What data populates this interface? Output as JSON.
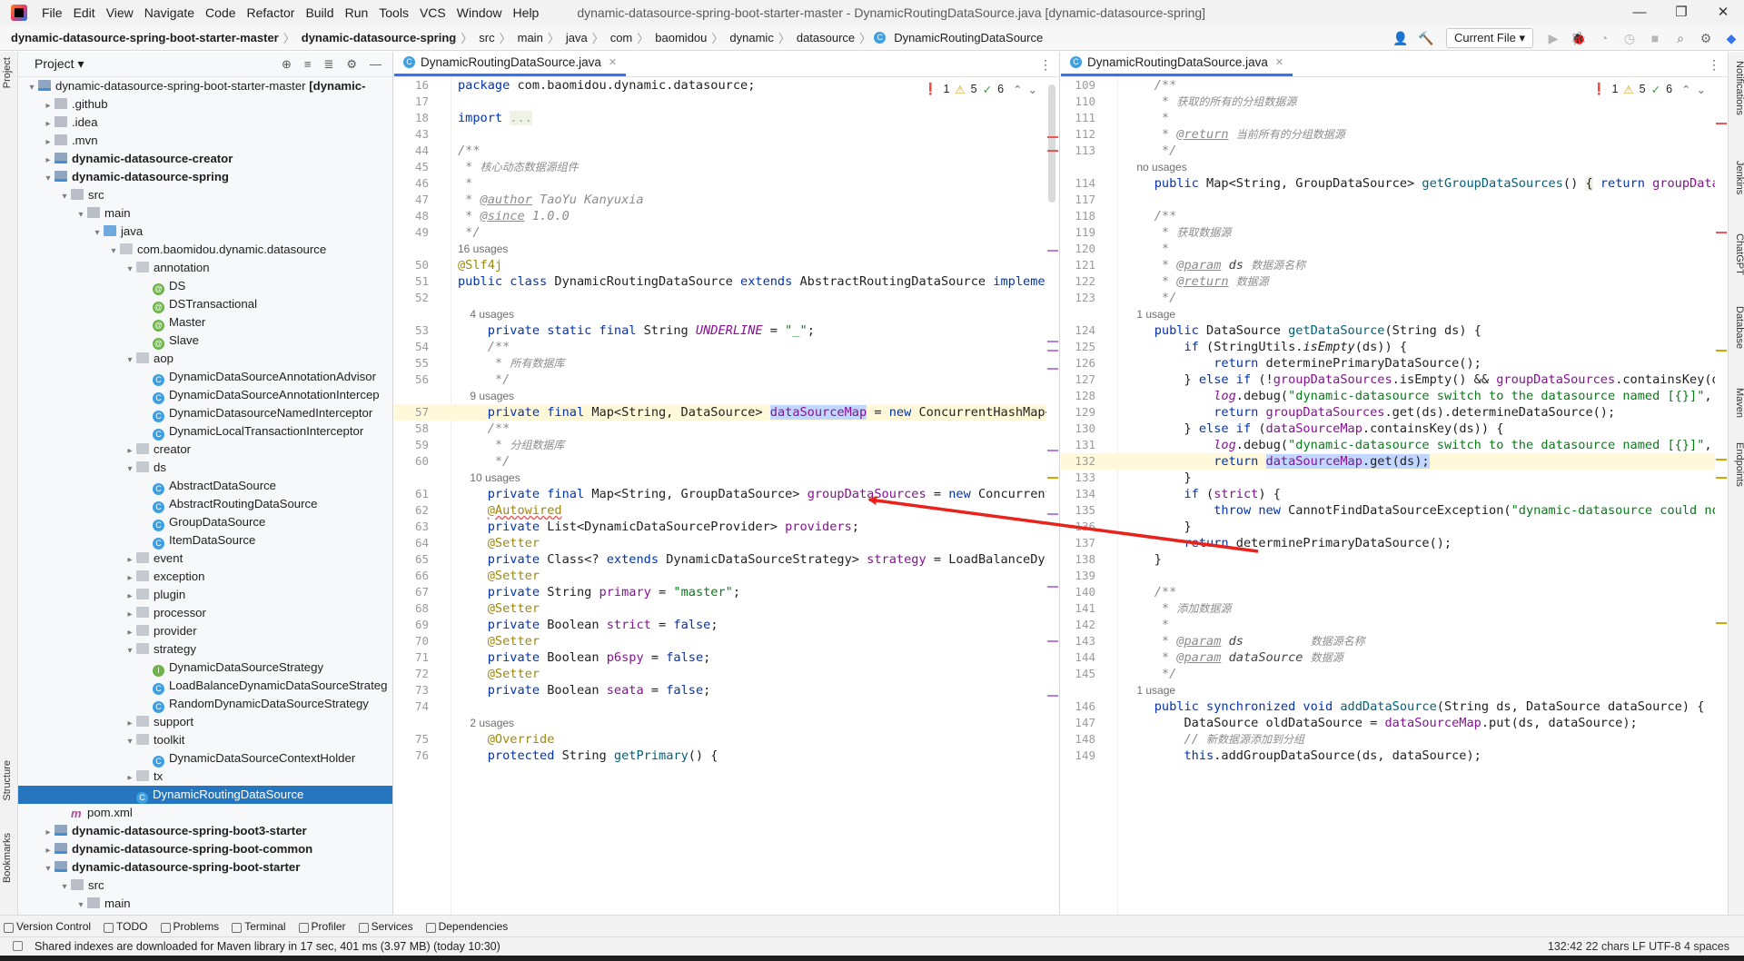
{
  "menu": [
    "File",
    "Edit",
    "View",
    "Navigate",
    "Code",
    "Refactor",
    "Build",
    "Run",
    "Tools",
    "VCS",
    "Window",
    "Help"
  ],
  "window_title": "dynamic-datasource-spring-boot-starter-master - DynamicRoutingDataSource.java [dynamic-datasource-spring]",
  "window_controls": {
    "minimize": "—",
    "restore": "❐",
    "close": "✕"
  },
  "breadcrumbs": [
    {
      "label": "dynamic-datasource-spring-boot-starter-master",
      "bold": true
    },
    {
      "label": "dynamic-datasource-spring",
      "bold": true
    },
    {
      "label": "src"
    },
    {
      "label": "main"
    },
    {
      "label": "java"
    },
    {
      "label": "com"
    },
    {
      "label": "baomidou"
    },
    {
      "label": "dynamic"
    },
    {
      "label": "datasource"
    },
    {
      "label": "DynamicRoutingDataSource",
      "icon": "C"
    }
  ],
  "run_config": "Current File ▾",
  "left_strip": [
    "Project",
    "Structure",
    "Bookmarks"
  ],
  "right_strip": [
    "Notifications",
    "Jenkins",
    "ChatGPT",
    "Database",
    "Maven",
    "Endpoints"
  ],
  "project_panel": {
    "title": "Project ▾"
  },
  "tree": [
    {
      "d": 0,
      "a": "▾",
      "i": "module",
      "t": "dynamic-datasource-spring-boot-starter-master",
      "extra": " [dynamic-",
      "bold": false
    },
    {
      "d": 1,
      "a": "▸",
      "i": "folder",
      "t": ".github"
    },
    {
      "d": 1,
      "a": "▸",
      "i": "folder",
      "t": ".idea"
    },
    {
      "d": 1,
      "a": "▸",
      "i": "folder",
      "t": ".mvn"
    },
    {
      "d": 1,
      "a": "▸",
      "i": "module",
      "t": "dynamic-datasource-creator",
      "bold": true
    },
    {
      "d": 1,
      "a": "▾",
      "i": "module",
      "t": "dynamic-datasource-spring",
      "bold": true
    },
    {
      "d": 2,
      "a": "▾",
      "i": "folder",
      "t": "src"
    },
    {
      "d": 3,
      "a": "▾",
      "i": "folder",
      "t": "main"
    },
    {
      "d": 4,
      "a": "▾",
      "i": "folder-blue",
      "t": "java"
    },
    {
      "d": 5,
      "a": "▾",
      "i": "package",
      "t": "com.baomidou.dynamic.datasource"
    },
    {
      "d": 6,
      "a": "▾",
      "i": "package",
      "t": "annotation"
    },
    {
      "d": 7,
      "a": "",
      "i": "ann",
      "t": "DS"
    },
    {
      "d": 7,
      "a": "",
      "i": "ann",
      "t": "DSTransactional"
    },
    {
      "d": 7,
      "a": "",
      "i": "ann",
      "t": "Master"
    },
    {
      "d": 7,
      "a": "",
      "i": "ann",
      "t": "Slave"
    },
    {
      "d": 6,
      "a": "▾",
      "i": "package",
      "t": "aop"
    },
    {
      "d": 7,
      "a": "",
      "i": "cls",
      "t": "DynamicDataSourceAnnotationAdvisor"
    },
    {
      "d": 7,
      "a": "",
      "i": "cls",
      "t": "DynamicDataSourceAnnotationIntercep"
    },
    {
      "d": 7,
      "a": "",
      "i": "cls",
      "t": "DynamicDatasourceNamedInterceptor"
    },
    {
      "d": 7,
      "a": "",
      "i": "cls",
      "t": "DynamicLocalTransactionInterceptor"
    },
    {
      "d": 6,
      "a": "▸",
      "i": "package",
      "t": "creator"
    },
    {
      "d": 6,
      "a": "▾",
      "i": "package",
      "t": "ds"
    },
    {
      "d": 7,
      "a": "",
      "i": "cls",
      "t": "AbstractDataSource"
    },
    {
      "d": 7,
      "a": "",
      "i": "cls",
      "t": "AbstractRoutingDataSource"
    },
    {
      "d": 7,
      "a": "",
      "i": "cls",
      "t": "GroupDataSource"
    },
    {
      "d": 7,
      "a": "",
      "i": "cls",
      "t": "ItemDataSource"
    },
    {
      "d": 6,
      "a": "▸",
      "i": "package",
      "t": "event"
    },
    {
      "d": 6,
      "a": "▸",
      "i": "package",
      "t": "exception"
    },
    {
      "d": 6,
      "a": "▸",
      "i": "package",
      "t": "plugin"
    },
    {
      "d": 6,
      "a": "▸",
      "i": "package",
      "t": "processor"
    },
    {
      "d": 6,
      "a": "▸",
      "i": "package",
      "t": "provider"
    },
    {
      "d": 6,
      "a": "▾",
      "i": "package",
      "t": "strategy"
    },
    {
      "d": 7,
      "a": "",
      "i": "iface",
      "t": "DynamicDataSourceStrategy"
    },
    {
      "d": 7,
      "a": "",
      "i": "cls",
      "t": "LoadBalanceDynamicDataSourceStrateg"
    },
    {
      "d": 7,
      "a": "",
      "i": "cls",
      "t": "RandomDynamicDataSourceStrategy"
    },
    {
      "d": 6,
      "a": "▸",
      "i": "package",
      "t": "support"
    },
    {
      "d": 6,
      "a": "▾",
      "i": "package",
      "t": "toolkit"
    },
    {
      "d": 7,
      "a": "",
      "i": "cls",
      "t": "DynamicDataSourceContextHolder"
    },
    {
      "d": 6,
      "a": "▸",
      "i": "package",
      "t": "tx"
    },
    {
      "d": 6,
      "a": "",
      "i": "cls",
      "t": "DynamicRoutingDataSource",
      "selected": true
    },
    {
      "d": 2,
      "a": "",
      "i": "maven",
      "t": "pom.xml"
    },
    {
      "d": 1,
      "a": "▸",
      "i": "module",
      "t": "dynamic-datasource-spring-boot3-starter",
      "bold": true
    },
    {
      "d": 1,
      "a": "▸",
      "i": "module",
      "t": "dynamic-datasource-spring-boot-common",
      "bold": true
    },
    {
      "d": 1,
      "a": "▾",
      "i": "module",
      "t": "dynamic-datasource-spring-boot-starter",
      "bold": true
    },
    {
      "d": 2,
      "a": "▾",
      "i": "folder",
      "t": "src"
    },
    {
      "d": 3,
      "a": "▾",
      "i": "folder",
      "t": "main"
    }
  ],
  "editor_left": {
    "tab": "DynamicRoutingDataSource.java",
    "inspections": {
      "errors": "1",
      "warnings": "5",
      "ok": "6"
    },
    "lines": [
      {
        "n": "16",
        "h": "<span class=\"kw\">package</span> com.baomidou.dynamic.datasource;"
      },
      {
        "n": "17",
        "h": ""
      },
      {
        "n": "18",
        "h": "<span class=\"kw\">import</span> <span class=\"fold\" style=\"background:#eef3e6\">...</span>"
      },
      {
        "n": "43",
        "h": ""
      },
      {
        "n": "44",
        "h": "<span class=\"cm\">/**</span>"
      },
      {
        "n": "45",
        "h": "<span class=\"cm\"> * </span><span class=\"cmcn\">核心动态数据源组件</span>"
      },
      {
        "n": "46",
        "h": "<span class=\"cm\"> *</span>"
      },
      {
        "n": "47",
        "h": "<span class=\"cm\"> * <span class=\"tag\">@author</span> TaoYu Kanyuxia</span>"
      },
      {
        "n": "48",
        "h": "<span class=\"cm\"> * <span class=\"tag\">@since</span> 1.0.0</span>"
      },
      {
        "n": "49",
        "h": "<span class=\"cm\"> */</span>"
      },
      {
        "n": "",
        "hint": "16 usages"
      },
      {
        "n": "50",
        "h": "<span class=\"ann\">@Slf4j</span>"
      },
      {
        "n": "51",
        "h": "<span class=\"kw\">public class</span> DynamicRoutingDataSource <span class=\"kw\">extends</span> AbstractRoutingDataSource <span class=\"kw\">implements</span>"
      },
      {
        "n": "52",
        "h": ""
      },
      {
        "n": "",
        "hint": "    4 usages"
      },
      {
        "n": "53",
        "h": "    <span class=\"kw\">private static final</span> String <span class=\"stat\">UNDERLINE</span> = <span class=\"str\">\"_\"</span>;"
      },
      {
        "n": "54",
        "h": "    <span class=\"cm\">/**</span>"
      },
      {
        "n": "55",
        "h": "    <span class=\"cm\"> * </span><span class=\"cmcn\">所有数据库</span>"
      },
      {
        "n": "56",
        "h": "    <span class=\"cm\"> */</span>"
      },
      {
        "n": "",
        "hint": "    9 usages"
      },
      {
        "n": "57",
        "h": "    <span class=\"kw\">private final</span> Map&lt;String, DataSource&gt; <span class=\"fld hl\">dataSourceMap</span> = <span class=\"kw\">new</span> ConcurrentHashMap&lt;&gt;()",
        "current": true
      },
      {
        "n": "58",
        "h": "    <span class=\"cm\">/**</span>"
      },
      {
        "n": "59",
        "h": "    <span class=\"cm\"> * </span><span class=\"cmcn\">分组数据库</span>"
      },
      {
        "n": "60",
        "h": "    <span class=\"cm\"> */</span>"
      },
      {
        "n": "",
        "hint": "    10 usages"
      },
      {
        "n": "61",
        "h": "    <span class=\"kw\">private final</span> Map&lt;String, GroupDataSource&gt; <span class=\"fld\">groupDataSources</span> = <span class=\"kw\">new</span> ConcurrentHas"
      },
      {
        "n": "62",
        "h": "    <span class=\"ann err-wave\">@Autowired</span>"
      },
      {
        "n": "63",
        "h": "    <span class=\"kw\">private</span> List&lt;DynamicDataSourceProvider&gt; <span class=\"fld\">providers</span>;"
      },
      {
        "n": "64",
        "h": "    <span class=\"ann\">@Setter</span>"
      },
      {
        "n": "65",
        "h": "    <span class=\"kw\">private</span> Class&lt;? <span class=\"kw\">extends</span> DynamicDataSourceStrategy&gt; <span class=\"fld\">strategy</span> = LoadBalanceDynami"
      },
      {
        "n": "66",
        "h": "    <span class=\"ann\">@Setter</span>"
      },
      {
        "n": "67",
        "h": "    <span class=\"kw\">private</span> String <span class=\"fld\">primary</span> = <span class=\"str\">\"master\"</span>;"
      },
      {
        "n": "68",
        "h": "    <span class=\"ann\">@Setter</span>"
      },
      {
        "n": "69",
        "h": "    <span class=\"kw\">private</span> Boolean <span class=\"fld\">strict</span> = <span class=\"kw\">false</span>;"
      },
      {
        "n": "70",
        "h": "    <span class=\"ann\">@Setter</span>"
      },
      {
        "n": "71",
        "h": "    <span class=\"kw\">private</span> Boolean <span class=\"fld\">p6spy</span> = <span class=\"kw\">false</span>;"
      },
      {
        "n": "72",
        "h": "    <span class=\"ann\">@Setter</span>"
      },
      {
        "n": "73",
        "h": "    <span class=\"kw\">private</span> Boolean <span class=\"fld\">seata</span> = <span class=\"kw\">false</span>;"
      },
      {
        "n": "74",
        "h": ""
      },
      {
        "n": "",
        "hint": "    2 usages"
      },
      {
        "n": "75",
        "h": "    <span class=\"ann\">@Override</span>"
      },
      {
        "n": "76",
        "h": "    <span class=\"kw\">protected</span> String <span class=\"mth\">getPrimary</span>() {"
      }
    ]
  },
  "editor_right": {
    "tab": "DynamicRoutingDataSource.java",
    "inspections": {
      "errors": "1",
      "warnings": "5",
      "ok": "6"
    },
    "lines": [
      {
        "n": "109",
        "h": "    <span class=\"cm\">/**</span>"
      },
      {
        "n": "110",
        "h": "    <span class=\"cm\"> * </span><span class=\"cmcn\">获取的所有的分组数据源</span>"
      },
      {
        "n": "111",
        "h": "    <span class=\"cm\"> *</span>"
      },
      {
        "n": "112",
        "h": "    <span class=\"cm\"> * <span class=\"tag\">@return</span> </span><span class=\"cmcn\">当前所有的分组数据源</span>"
      },
      {
        "n": "113",
        "h": "    <span class=\"cm\"> */</span>"
      },
      {
        "n": "",
        "hint": "    no usages"
      },
      {
        "n": "114",
        "h": "    <span class=\"kw\">public</span> Map&lt;String, GroupDataSource&gt; <span class=\"mth\">getGroupDataSources</span>() <span style=\"background:#eef3e6\">{</span> <span class=\"kw\">return</span> <span class=\"fld\">groupDataSou</span>"
      },
      {
        "n": "117",
        "h": ""
      },
      {
        "n": "118",
        "h": "    <span class=\"cm\">/**</span>"
      },
      {
        "n": "119",
        "h": "    <span class=\"cm\"> * </span><span class=\"cmcn\">获取数据源</span>"
      },
      {
        "n": "120",
        "h": "    <span class=\"cm\"> *</span>"
      },
      {
        "n": "121",
        "h": "    <span class=\"cm\"> * <span class=\"tag\">@param</span> <span style=\"color:#444\">ds</span> </span><span class=\"cmcn\">数据源名称</span>"
      },
      {
        "n": "122",
        "h": "    <span class=\"cm\"> * <span class=\"tag\">@return</span> </span><span class=\"cmcn\">数据源</span>"
      },
      {
        "n": "123",
        "h": "    <span class=\"cm\"> */</span>"
      },
      {
        "n": "",
        "hint": "    1 usage"
      },
      {
        "n": "124",
        "h": "    <span class=\"kw\">public</span> DataSource <span class=\"mth\">getDataSource</span>(String ds) {"
      },
      {
        "n": "125",
        "h": "        <span class=\"kw\">if</span> (StringUtils.<i>isEmpty</i>(ds)) {"
      },
      {
        "n": "126",
        "h": "            <span class=\"kw\">return</span> determinePrimaryDataSource();"
      },
      {
        "n": "127",
        "h": "        } <span class=\"kw\">else if</span> (!<span class=\"fld\">groupDataSources</span>.isEmpty() &amp;&amp; <span class=\"fld\">groupDataSources</span>.containsKey(ds))"
      },
      {
        "n": "128",
        "h": "            <span class=\"stat\">log</span>.debug(<span class=\"str\">\"dynamic-datasource switch to the datasource named [{}]\"</span>, ds)"
      },
      {
        "n": "129",
        "h": "            <span class=\"kw\">return</span> <span class=\"fld\">groupDataSources</span>.get(ds).determineDataSource();"
      },
      {
        "n": "130",
        "h": "        } <span class=\"kw\">else if</span> (<span class=\"fld\">dataSourceMap</span>.containsKey(ds)) {"
      },
      {
        "n": "131",
        "h": "            <span class=\"stat\">log</span>.debug(<span class=\"str\">\"dynamic-datasource switch to the datasource named [{}]\"</span>, ds)"
      },
      {
        "n": "132",
        "h": "            <span class=\"kw\">return</span> <span class=\"hl\"><span class=\"fld\">dataSourceMap</span>.get(ds);</span>",
        "current": true
      },
      {
        "n": "133",
        "h": "        }"
      },
      {
        "n": "134",
        "h": "        <span class=\"kw\">if</span> (<span class=\"fld\">strict</span>) {"
      },
      {
        "n": "135",
        "h": "            <span class=\"kw\">throw new</span> CannotFindDataSourceException(<span class=\"str\">\"dynamic-datasource could not f</span>"
      },
      {
        "n": "136",
        "h": "        }"
      },
      {
        "n": "137",
        "h": "        <span class=\"kw\">return</span> determinePrimaryDataSource();"
      },
      {
        "n": "138",
        "h": "    }"
      },
      {
        "n": "139",
        "h": ""
      },
      {
        "n": "140",
        "h": "    <span class=\"cm\">/**</span>"
      },
      {
        "n": "141",
        "h": "    <span class=\"cm\"> * </span><span class=\"cmcn\">添加数据源</span>"
      },
      {
        "n": "142",
        "h": "    <span class=\"cm\"> *</span>"
      },
      {
        "n": "143",
        "h": "    <span class=\"cm\"> * <span class=\"tag\">@param</span> <span style=\"color:#444\">ds</span>         </span><span class=\"cmcn\">数据源名称</span>"
      },
      {
        "n": "144",
        "h": "    <span class=\"cm\"> * <span class=\"tag\">@param</span> <span style=\"color:#444\">dataSource</span> </span><span class=\"cmcn\">数据源</span>"
      },
      {
        "n": "145",
        "h": "    <span class=\"cm\"> */</span>"
      },
      {
        "n": "",
        "hint": "    1 usage"
      },
      {
        "n": "146",
        "h": "    <span class=\"kw\">public synchronized void</span> <span class=\"mth\">addDataSource</span>(String ds, DataSource dataSource) {"
      },
      {
        "n": "147",
        "h": "        DataSource oldDataSource = <span class=\"fld\">dataSourceMap</span>.put(ds, dataSource);"
      },
      {
        "n": "148",
        "h": "        <span class=\"cm\">// </span><span class=\"cmcn\">新数据源添加到分组</span>"
      },
      {
        "n": "149",
        "h": "        <span class=\"kw\">this</span>.addGroupDataSource(ds, dataSource);"
      }
    ]
  },
  "bottom_tools": [
    "Version Control",
    "TODO",
    "Problems",
    "Terminal",
    "Profiler",
    "Services",
    "Dependencies"
  ],
  "status": {
    "message": "Shared indexes are downloaded for Maven library in 17 sec, 401 ms (3.97 MB) (today 10:30)",
    "right": "132:42  22 chars  LF  UTF-8  4 spaces"
  },
  "colors": {
    "accent": "#3574f0",
    "selection": "#2675bf",
    "arrow": "#e8231b"
  }
}
